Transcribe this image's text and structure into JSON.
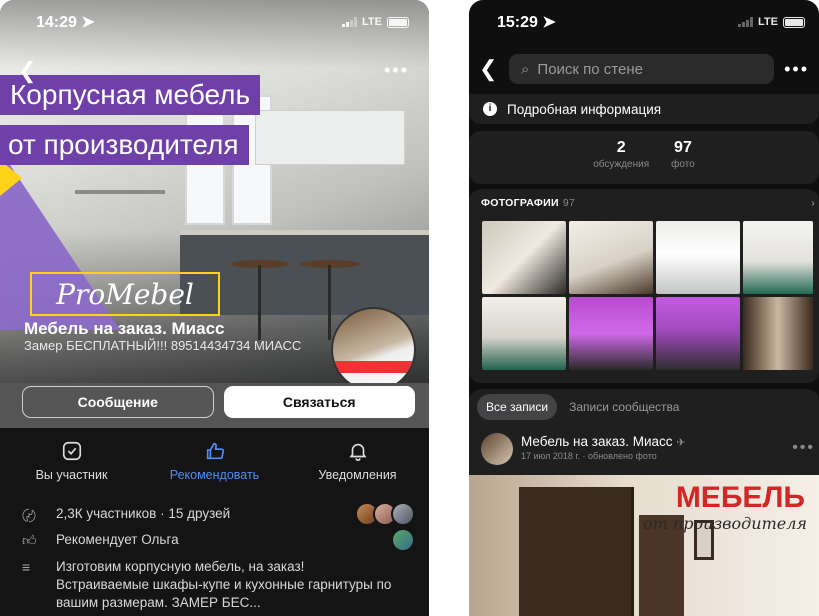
{
  "left": {
    "status": {
      "time": "14:29",
      "network": "LTE"
    },
    "cover": {
      "banner_line1": "Корпусная мебель",
      "banner_line2": "от производителя",
      "logo_text": "ProMebel"
    },
    "group": {
      "name": "Мебель на заказ. Миасс",
      "subtitle": "Замер БЕСПЛАТНЫЙ!!! 89514434734 МИАСС"
    },
    "actions": {
      "message": "Сообщение",
      "contact": "Связаться"
    },
    "tabs": [
      {
        "label": "Вы участник",
        "icon": "check-square-icon"
      },
      {
        "label": "Рекомендовать",
        "icon": "thumbs-up-icon"
      },
      {
        "label": "Уведомления",
        "icon": "bell-icon"
      }
    ],
    "info": {
      "members": "2,3К участников · 15 друзей",
      "recommend": "Рекомендует Ольга",
      "description": "Изготовим корпусную мебель, на заказ! Встраиваемые шкафы-купе и кухонные гарнитуры по вашим размерам. ЗАМЕР БЕС..."
    }
  },
  "right": {
    "status": {
      "time": "15:29",
      "network": "LTE"
    },
    "search": {
      "placeholder": "Поиск по стене"
    },
    "details_label": "Подробная информация",
    "stats": [
      {
        "value": "2",
        "label": "обсуждения"
      },
      {
        "value": "97",
        "label": "фото"
      }
    ],
    "photos": {
      "title": "ФОТОГРАФИИ",
      "count": "97"
    },
    "chips": {
      "all": "Все записи",
      "community": "Записи сообщества"
    },
    "post": {
      "author": "Мебель на заказ. Миасс",
      "date": "17 июл 2018 г. · обновлено фото",
      "image_title": "МЕБЕЛЬ",
      "image_subtitle": "от производителя"
    }
  },
  "colors": {
    "accent_blue": "#4f8ff7",
    "banner_purple": "#6f40a8",
    "brand_red": "#d32626",
    "logo_yellow": "#ffd21a"
  }
}
